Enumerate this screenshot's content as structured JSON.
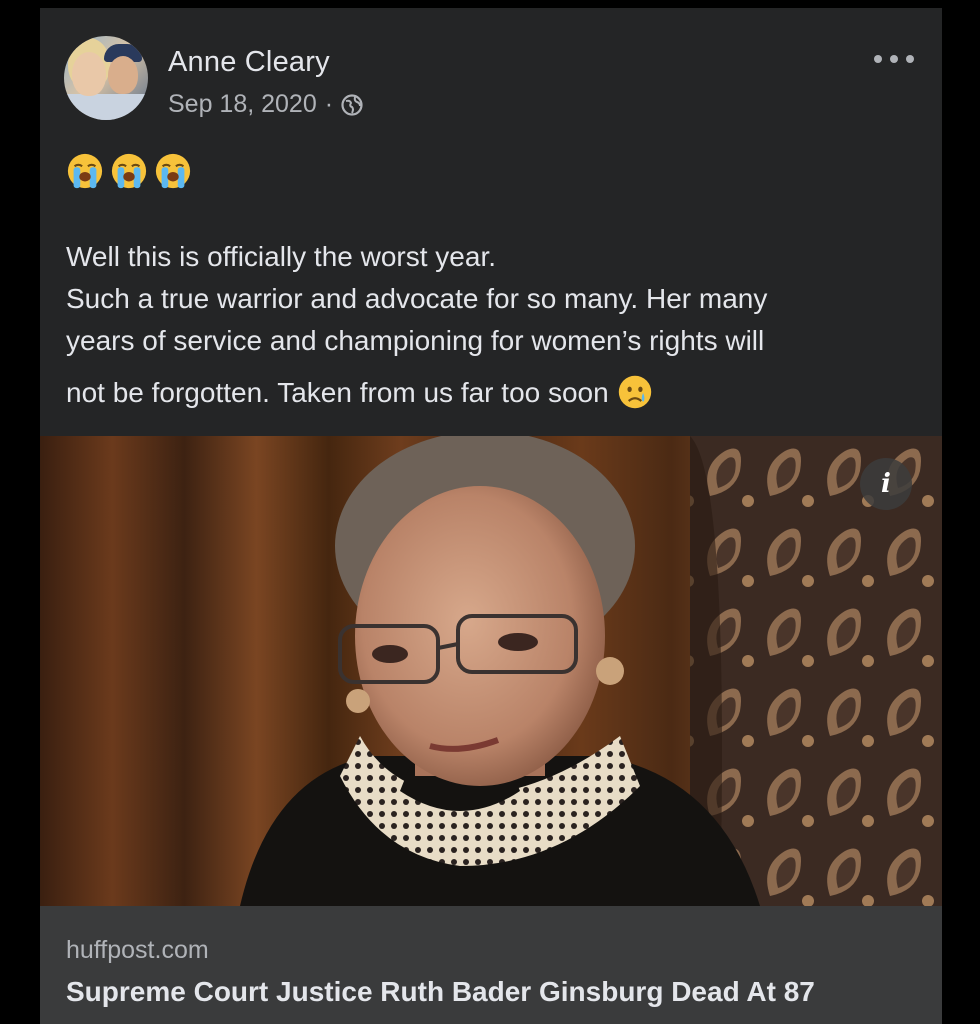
{
  "post": {
    "author": "Anne Cleary",
    "date": "Sep 18, 2020",
    "separator": "·",
    "privacy_icon": "globe-icon",
    "menu_icon": "more-options-icon",
    "reaction_emojis": [
      "loudly-crying-face",
      "loudly-crying-face",
      "loudly-crying-face"
    ],
    "text_lines": [
      "Well this is officially the worst year.",
      "Such a true warrior and advocate for so many. Her many",
      "years of service and championing for women’s rights will",
      "not be forgotten. Taken from us far too soon"
    ],
    "trailing_emoji": "crying-face"
  },
  "link_preview": {
    "info_label": "i",
    "domain": "huffpost.com",
    "title": "Supreme Court Justice Ruth Bader Ginsburg Dead At 87"
  },
  "colors": {
    "page_background": "#000000",
    "card_background": "#242526",
    "footer_background": "#3a3b3c",
    "primary_text": "#e4e6eb",
    "secondary_text": "#b0b3b8"
  }
}
